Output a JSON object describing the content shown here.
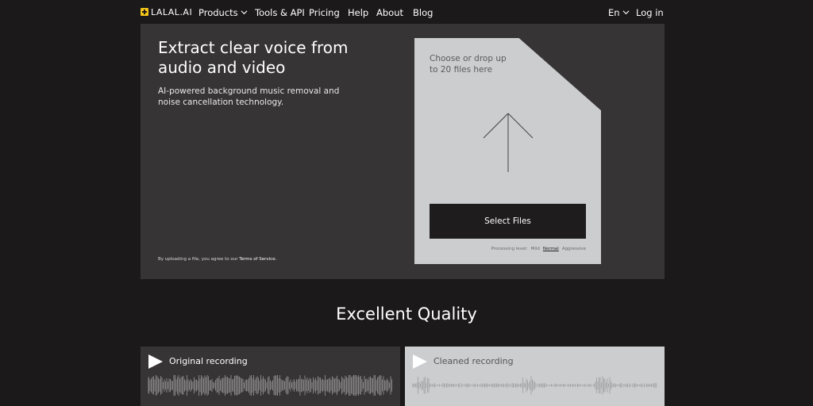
{
  "nav": {
    "logo": "LALAL.AI",
    "products": "Products",
    "tools": "Tools & API",
    "pricing": "Pricing",
    "help": "Help",
    "about": "About",
    "blog": "Blog",
    "language": "En",
    "login": "Log in"
  },
  "hero": {
    "title": "Extract clear voice from audio and video",
    "subtitle": "AI-powered background music removal and noise cancellation technology.",
    "tos_prefix": "By uploading a file, you agree to our ",
    "tos_link": "Terms of Service.",
    "drop_text": "Choose or drop up to 20 files here",
    "select_button": "Select Files",
    "processing_label": "Processing level:",
    "levels": [
      "Mild",
      "Normal",
      "Aggressive"
    ],
    "selected_level": "Normal"
  },
  "quality": {
    "title": "Excellent Quality",
    "cards": [
      {
        "label": "Original recording"
      },
      {
        "label": "Cleaned recording"
      }
    ]
  },
  "colors": {
    "background": "#1b191a",
    "panel": "#363435",
    "dropzone": "#cccdcf",
    "button": "#1e1c1d",
    "logo_accent": "#f5c518"
  }
}
